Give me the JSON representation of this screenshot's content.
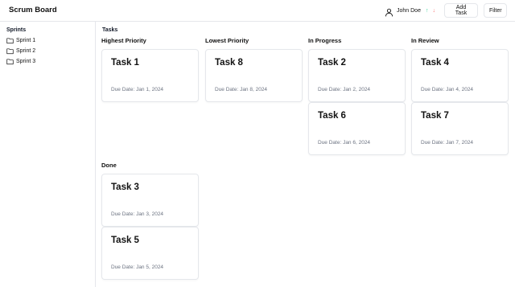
{
  "header": {
    "title": "Scrum Board",
    "user_name": "John Doe",
    "user_icon": "user-icon",
    "arrow_up": "↑",
    "arrow_down": "↓",
    "add_task_label": "Add Task",
    "filter_label": "Filter"
  },
  "sidebar": {
    "title": "Sprints",
    "items": [
      {
        "label": "Sprint 1",
        "icon": "folder-icon"
      },
      {
        "label": "Sprint 2",
        "icon": "folder-icon"
      },
      {
        "label": "Sprint 3",
        "icon": "folder-icon"
      }
    ]
  },
  "main": {
    "title": "Tasks",
    "columns": [
      {
        "title": "Highest Priority",
        "tasks": [
          {
            "title": "Task 1",
            "due": "Due Date: Jan 1, 2024"
          }
        ]
      },
      {
        "title": "Lowest Priority",
        "tasks": [
          {
            "title": "Task 8",
            "due": "Due Date: Jan 8, 2024"
          }
        ]
      },
      {
        "title": "In Progress",
        "tasks": [
          {
            "title": "Task 2",
            "due": "Due Date: Jan 2, 2024"
          },
          {
            "title": "Task 6",
            "due": "Due Date: Jan 6, 2024"
          }
        ]
      },
      {
        "title": "In Review",
        "tasks": [
          {
            "title": "Task 4",
            "due": "Due Date: Jan 4, 2024"
          },
          {
            "title": "Task 7",
            "due": "Due Date: Jan 7, 2024"
          }
        ]
      },
      {
        "title": "Done",
        "tasks": [
          {
            "title": "Task 3",
            "due": "Due Date: Jan 3, 2024"
          },
          {
            "title": "Task 5",
            "due": "Due Date: Jan 5, 2024"
          }
        ]
      }
    ]
  },
  "colors": {
    "arrow_up": "#34d399",
    "arrow_down": "#f87171",
    "border": "#e5e7eb",
    "muted_text": "#6b7280"
  }
}
